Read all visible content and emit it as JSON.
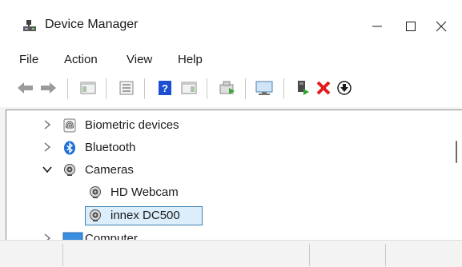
{
  "window": {
    "title": "Device Manager",
    "controls": [
      "minimize",
      "maximize",
      "close"
    ]
  },
  "menu": {
    "items": [
      {
        "label": "File"
      },
      {
        "label": "Action"
      },
      {
        "label": "View"
      },
      {
        "label": "Help"
      }
    ]
  },
  "toolbar": {
    "icons": [
      "back-arrow-icon",
      "forward-arrow-icon",
      "show-hide-console-tree-icon",
      "properties-icon",
      "help-icon",
      "show-action-pane-icon",
      "update-driver-icon",
      "scan-hardware-icon",
      "add-legacy-hardware-icon",
      "uninstall-device-icon",
      "disable-device-icon"
    ]
  },
  "tree": {
    "nodes": [
      {
        "label": "Biometric devices",
        "expanded": false,
        "level": 1,
        "icon": "fingerprint-icon"
      },
      {
        "label": "Bluetooth",
        "expanded": false,
        "level": 1,
        "icon": "bluetooth-icon"
      },
      {
        "label": "Cameras",
        "expanded": true,
        "level": 1,
        "icon": "camera-icon"
      },
      {
        "label": "HD Webcam",
        "level": 2,
        "icon": "webcam-icon"
      },
      {
        "label": "innex DC500",
        "level": 2,
        "icon": "webcam-icon",
        "selected": true
      },
      {
        "label": "Computer",
        "expanded": false,
        "level": 1,
        "icon": "computer-icon"
      }
    ]
  },
  "colors": {
    "selection_fill": "#dceefc",
    "selection_border": "#3c7fb1",
    "help_blue": "#1c4fd1",
    "uninstall_red": "#e21b1b",
    "bluetooth_blue": "#1e6fd9"
  }
}
